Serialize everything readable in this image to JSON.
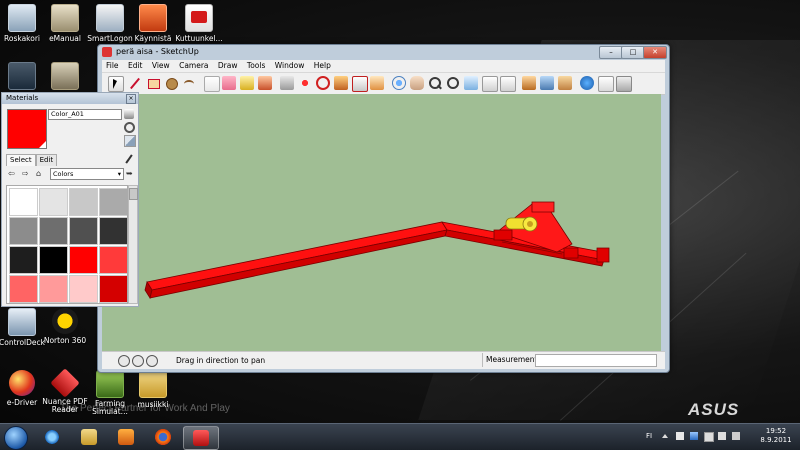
{
  "desktop": {
    "icons": [
      {
        "label": "Roskakori",
        "icon": "recycle-bin-icon"
      },
      {
        "label": "eManual",
        "icon": "emanual-icon"
      },
      {
        "label": "SmartLogon",
        "icon": "smartlogon-icon"
      },
      {
        "label": "Käynnistä",
        "icon": "sketchup-launch-icon"
      },
      {
        "label": "Kuttuunkel...",
        "icon": "pdf-file-icon"
      },
      {
        "label": "ControlDeck",
        "icon": "controldeck-icon"
      },
      {
        "label": "Norton 360",
        "icon": "norton-icon"
      },
      {
        "label": "e-Driver",
        "icon": "edriver-icon"
      },
      {
        "label": "Nuance PDF Reader",
        "icon": "nuance-pdf-icon"
      },
      {
        "label": "Farming Simulat...",
        "icon": "farming-simulator-icon"
      },
      {
        "label": "musiikki",
        "icon": "folder-icon"
      }
    ],
    "tagline": "The Perfect Partner for Work And Play",
    "brand": "ASUS"
  },
  "sketchup": {
    "title": "perä aisa - SketchUp",
    "menu": [
      "File",
      "Edit",
      "View",
      "Camera",
      "Draw",
      "Tools",
      "Window",
      "Help"
    ],
    "status_message": "Drag in direction to pan",
    "measurements_label": "Measurements",
    "window_controls": [
      "minimize",
      "maximize",
      "close"
    ],
    "viewport_bg": "#a0be94",
    "model_color": "#ff0000"
  },
  "materials": {
    "title": "Materials",
    "material_name": "Color_A01",
    "tabs": [
      "Select",
      "Edit"
    ],
    "library": "Colors",
    "selected_color": "#ff0000",
    "swatches": [
      "#ffffff",
      "#e4e4e4",
      "#c8c8c8",
      "#aaaaaa",
      "#8c8c8c",
      "#6e6e6e",
      "#505050",
      "#323232",
      "#1e1e1e",
      "#000000",
      "#ff0000",
      "#ff3a3a",
      "#ff6464",
      "#ff9a9a",
      "#ffcaca",
      "#d40000"
    ]
  },
  "taskbar": {
    "language": "FI",
    "time": "19:52",
    "date": "8.9.2011",
    "apps": [
      "internet-explorer-icon",
      "explorer-folder-icon",
      "media-player-icon",
      "firefox-icon",
      "sketchup-icon"
    ]
  }
}
